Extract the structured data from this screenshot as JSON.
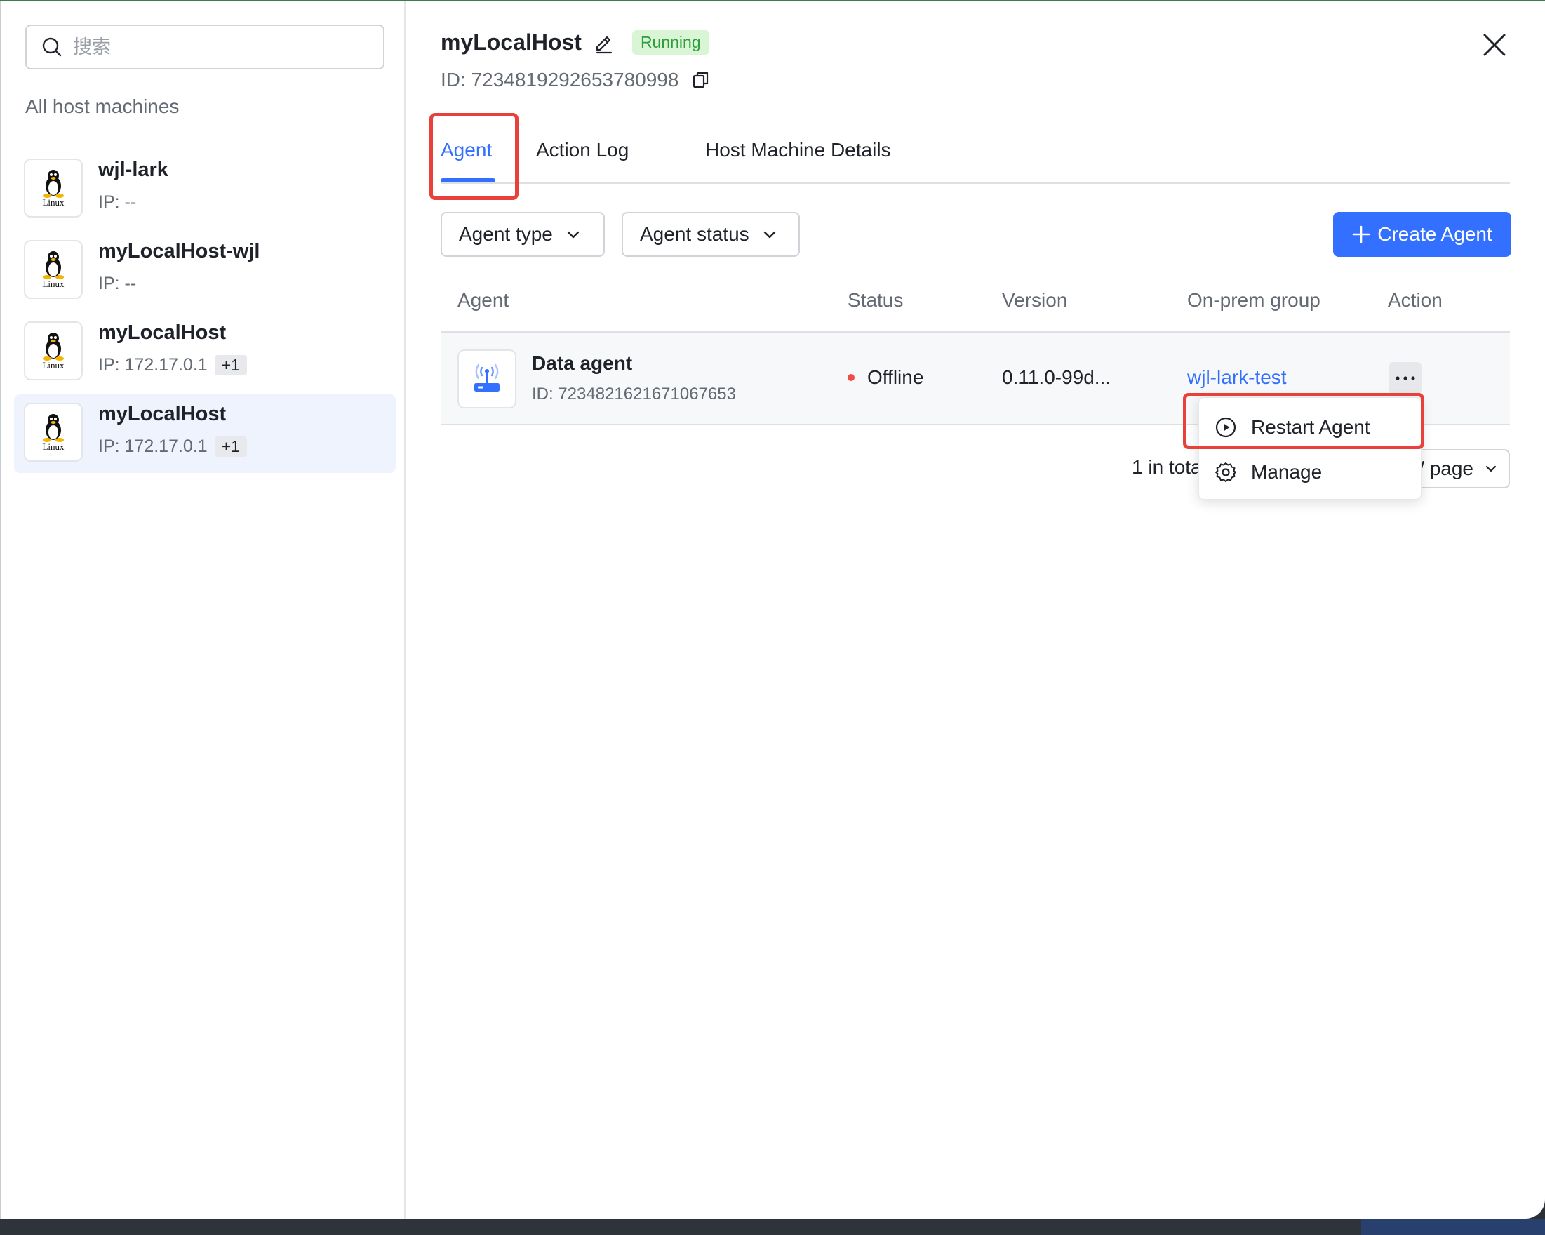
{
  "sidebar": {
    "search_placeholder": "搜索",
    "group_title": "All host machines",
    "items": [
      {
        "name": "wjl-lark",
        "ip": "IP: --",
        "extra": "",
        "os": "Linux"
      },
      {
        "name": "myLocalHost-wjl",
        "ip": "IP: --",
        "extra": "",
        "os": "Linux"
      },
      {
        "name": "myLocalHost",
        "ip": "IP: 172.17.0.1",
        "extra": "+1",
        "os": "Linux"
      },
      {
        "name": "myLocalHost",
        "ip": "IP: 172.17.0.1",
        "extra": "+1",
        "os": "Linux",
        "selected": true
      }
    ]
  },
  "header": {
    "title": "myLocalHost",
    "status": "Running",
    "id": "ID: 7234819292653780998"
  },
  "tabs": [
    {
      "label": "Agent",
      "active": true
    },
    {
      "label": "Action Log",
      "active": false
    },
    {
      "label": "Host Machine Details",
      "active": false
    }
  ],
  "filters": {
    "agent_type": "Agent type",
    "agent_status": "Agent status",
    "create_button": "Create Agent"
  },
  "table": {
    "columns": [
      "Agent",
      "Status",
      "Version",
      "On-prem group",
      "Action"
    ],
    "rows": [
      {
        "name": "Data agent",
        "id": "ID: 7234821621671067653",
        "status": "Offline",
        "version": "0.11.0-99d...",
        "group": "wjl-lark-test"
      }
    ]
  },
  "pagination": {
    "total": "1 in tota",
    "page_size": "/ page"
  },
  "menu": {
    "items": [
      {
        "label": "Restart Agent",
        "icon": "play-circle-icon"
      },
      {
        "label": "Manage",
        "icon": "gear-icon"
      }
    ]
  },
  "colors": {
    "accent": "#3370ff",
    "running": "#2e9d3c",
    "offline": "#f54a45",
    "highlight": "#e8403a"
  }
}
